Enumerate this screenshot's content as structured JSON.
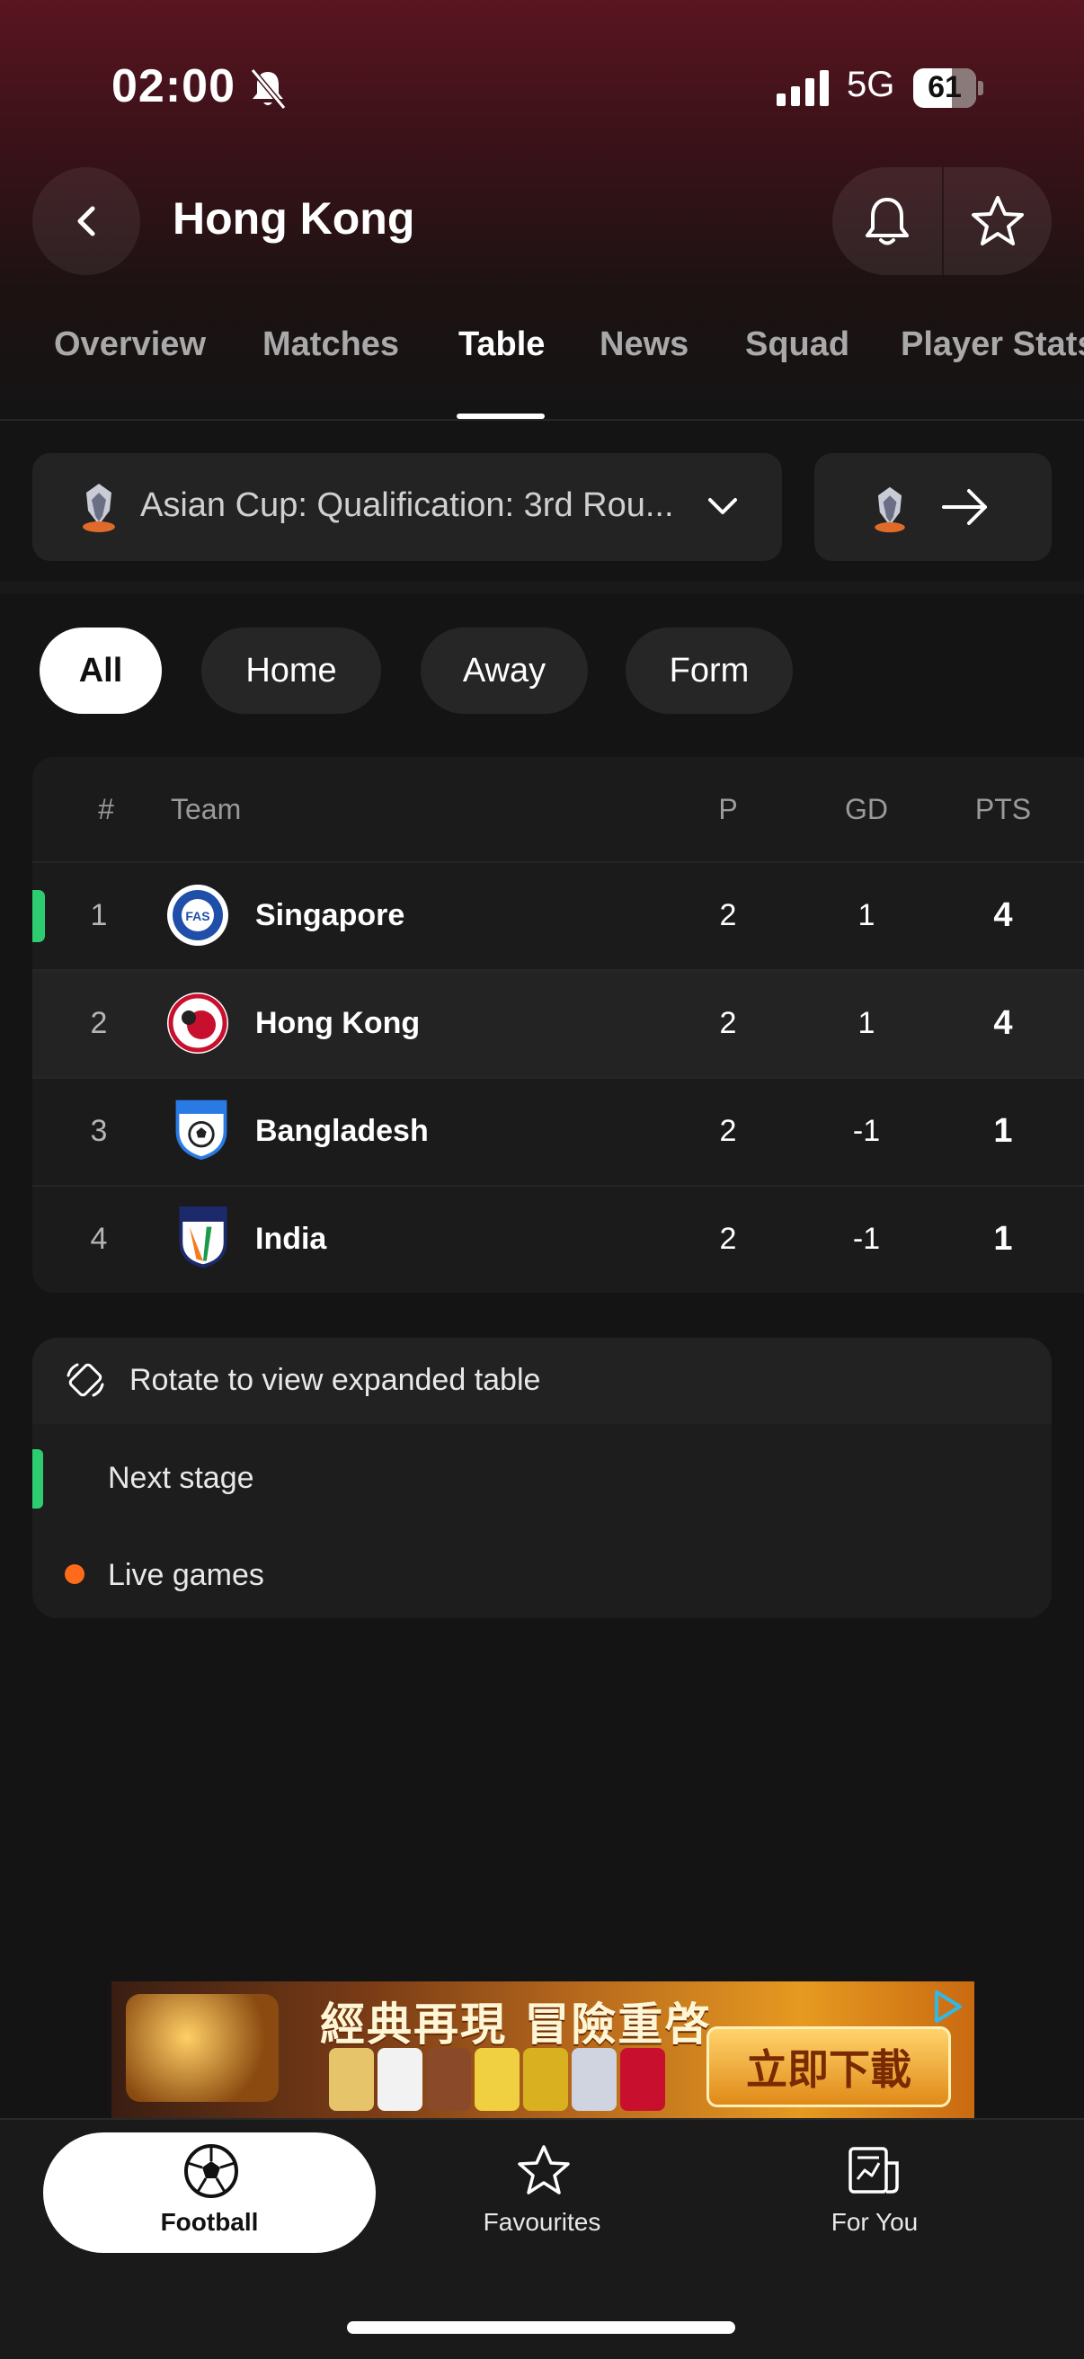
{
  "status_bar": {
    "time": "02:00",
    "network": "5G",
    "battery": "61"
  },
  "header": {
    "title": "Hong Kong"
  },
  "tabs": [
    "Overview",
    "Matches",
    "Table",
    "News",
    "Squad",
    "Player Stats"
  ],
  "active_tab": "Table",
  "competition": {
    "label": "Asian Cup: Qualification: 3rd Rou..."
  },
  "filters": [
    "All",
    "Home",
    "Away",
    "Form"
  ],
  "active_filter": "All",
  "table": {
    "headers": {
      "pos": "#",
      "team": "Team",
      "played": "P",
      "gd": "GD",
      "pts": "PTS"
    },
    "rows": [
      {
        "pos": "1",
        "team": "Singapore",
        "played": "2",
        "gd": "1",
        "pts": "4"
      },
      {
        "pos": "2",
        "team": "Hong Kong",
        "played": "2",
        "gd": "1",
        "pts": "4"
      },
      {
        "pos": "3",
        "team": "Bangladesh",
        "played": "2",
        "gd": "-1",
        "pts": "1"
      },
      {
        "pos": "4",
        "team": "India",
        "played": "2",
        "gd": "-1",
        "pts": "1"
      }
    ]
  },
  "legend": {
    "rotate": "Rotate to view expanded table",
    "next_stage": "Next stage",
    "live_games": "Live games"
  },
  "ad": {
    "headline": "經典再現 冒險重啓",
    "cta": "立即下載"
  },
  "bottom_nav": [
    {
      "label": "Football",
      "icon": "football-icon"
    },
    {
      "label": "Favourites",
      "icon": "star-icon"
    },
    {
      "label": "For You",
      "icon": "news-icon"
    }
  ],
  "colors": {
    "next_stage": "#2ecc71",
    "live": "#ff6b1a",
    "header_top": "#5a1521"
  }
}
